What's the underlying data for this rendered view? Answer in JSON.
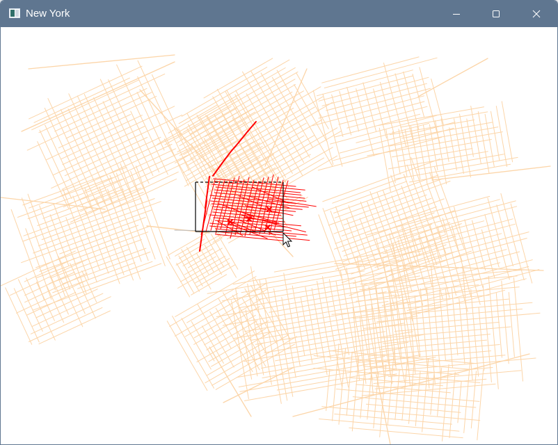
{
  "window": {
    "title": "New York",
    "icon": "app-window-icon",
    "controls": [
      "minimize-icon",
      "maximize-icon",
      "close-icon"
    ]
  },
  "map": {
    "colors": {
      "street": "#fcd5a8",
      "highlight": "#ff0000",
      "selection_solid": "#000000",
      "background": "#ffffff"
    },
    "selection_style": "rectangle with dashed top edge",
    "cursor": "arrow-cursor-icon"
  }
}
